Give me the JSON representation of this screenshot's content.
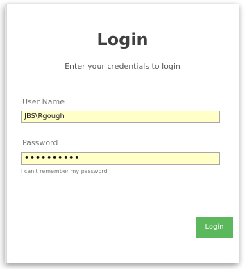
{
  "login": {
    "title": "Login",
    "subtitle": "Enter your credentials to login",
    "username_label": "User Name",
    "username_value": "JBS\\Rgough",
    "password_label": "Password",
    "password_value": "••••••••••",
    "forgot_link": "I can't remember my password",
    "submit_label": "Login"
  },
  "colors": {
    "input_background": "#ffffc7",
    "button_background": "#5cb85c",
    "title_text": "#404040"
  }
}
